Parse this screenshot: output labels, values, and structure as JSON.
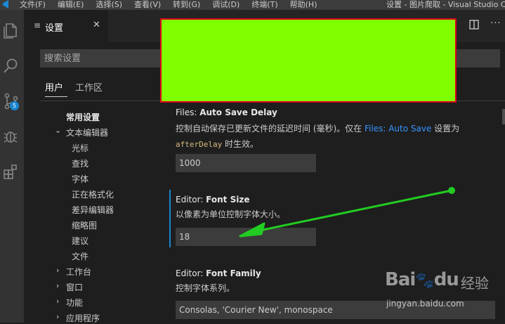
{
  "titlebar": {
    "menu": [
      "文件(F)",
      "编辑(E)",
      "选择(S)",
      "查看(V)",
      "转到(G)",
      "调试(D)",
      "终端(T)",
      "帮助(H)"
    ],
    "title": "设置 - 图片爬取 - Visual Studio C"
  },
  "activitybar": {
    "icons": [
      "explorer-icon",
      "search-icon",
      "source-control-icon",
      "debug-icon",
      "extensions-icon"
    ],
    "scm_badge": "5"
  },
  "editor_tab": {
    "label": "设置",
    "close": "✕"
  },
  "search": {
    "placeholder": "搜索设置"
  },
  "scope_tabs": {
    "user": "用户",
    "workspace": "工作区"
  },
  "toc": {
    "items": [
      {
        "label": "常用设置",
        "level": 0,
        "bold": true
      },
      {
        "label": "文本编辑器",
        "level": 0,
        "expanded": true
      },
      {
        "label": "光标",
        "level": 1
      },
      {
        "label": "查找",
        "level": 1
      },
      {
        "label": "字体",
        "level": 1
      },
      {
        "label": "正在格式化",
        "level": 1
      },
      {
        "label": "差异编辑器",
        "level": 1
      },
      {
        "label": "缩略图",
        "level": 1
      },
      {
        "label": "建议",
        "level": 1
      },
      {
        "label": "文件",
        "level": 1
      },
      {
        "label": "工作台",
        "level": 0,
        "expanded": false
      },
      {
        "label": "窗口",
        "level": 0,
        "expanded": false
      },
      {
        "label": "功能",
        "level": 0,
        "expanded": false
      },
      {
        "label": "应用程序",
        "level": 0,
        "expanded": false
      }
    ]
  },
  "settings": {
    "auto_save_delay": {
      "category": "Files: ",
      "name": "Auto Save Delay",
      "desc_part1": "控制自动保存已更新文件的延迟时间 (毫秒)。仅在 ",
      "desc_link": "Files: Auto Save",
      "desc_part2": " 设置为",
      "desc_code": "afterDelay",
      "desc_part3": " 时生效。",
      "value": "1000"
    },
    "font_size": {
      "category": "Editor: ",
      "name": "Font Size",
      "desc": "以像素为单位控制字体大小。",
      "value": "18"
    },
    "font_family": {
      "category": "Editor: ",
      "name": "Font Family",
      "desc": "控制字体系列。",
      "value": "Consolas, 'Courier New', monospace"
    }
  },
  "colors": {
    "accent": "#1a85d0",
    "annotation_box": "#80ff00",
    "annotation_border": "#e0001a",
    "annotation_arrow": "#22cc22"
  },
  "watermark": {
    "logo": "Bai",
    "logo_suffix": "du",
    "sub": "经验",
    "url": "jingyan.baidu.com"
  }
}
